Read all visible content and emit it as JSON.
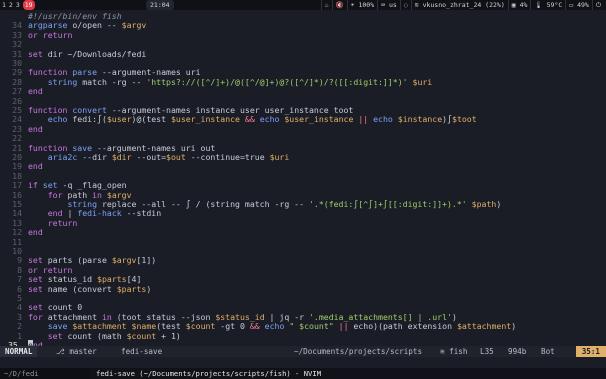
{
  "topbar": {
    "workspaces": [
      "1",
      "2",
      "3",
      "19"
    ],
    "active_workspace": "19",
    "clock": "21:04",
    "status_items": [
      {
        "icon": "steam-icon",
        "text": ""
      },
      {
        "icon": "volume-muted-icon",
        "text": ""
      },
      {
        "icon": "brightness-icon",
        "text": "100%"
      },
      {
        "icon": "keyboard-icon",
        "text": "us"
      },
      {
        "icon": "eye-off-icon",
        "text": ""
      },
      {
        "icon": "wifi-icon",
        "text": "vkusno_zhrat_24 (22%)"
      },
      {
        "icon": "cpu-icon",
        "text": "4%"
      },
      {
        "icon": "temperature-icon",
        "text": "59°C"
      },
      {
        "icon": "battery-icon",
        "text": "49%"
      },
      {
        "icon": "power-icon",
        "text": ""
      }
    ]
  },
  "editor": {
    "lines": [
      {
        "ln": "",
        "tokens": [
          [
            "cmt",
            "#!/usr/bin/env fish"
          ]
        ]
      },
      {
        "ln": "34",
        "tokens": [
          [
            "fn",
            "argparse"
          ],
          [
            "plain",
            " o/open -- "
          ],
          [
            "var",
            "$argv"
          ]
        ]
      },
      {
        "ln": "33",
        "tokens": [
          [
            "kw",
            "or"
          ],
          [
            "plain",
            " "
          ],
          [
            "kw",
            "return"
          ]
        ]
      },
      {
        "ln": "32",
        "tokens": []
      },
      {
        "ln": "31",
        "tokens": [
          [
            "kw",
            "set"
          ],
          [
            "plain",
            " dir ~/Downloads/fedi"
          ]
        ]
      },
      {
        "ln": "30",
        "tokens": []
      },
      {
        "ln": "29",
        "tokens": [
          [
            "kw",
            "function"
          ],
          [
            "plain",
            " "
          ],
          [
            "fn",
            "parse"
          ],
          [
            "plain",
            " --argument-names uri"
          ]
        ]
      },
      {
        "ln": "28",
        "tokens": [
          [
            "plain",
            "    "
          ],
          [
            "fn",
            "string"
          ],
          [
            "plain",
            " match -rg -- "
          ],
          [
            "str",
            "'https?://([^/]+)/@([^/@]+)@?([^/]*)/?([[:digit:]]*)'"
          ],
          [
            "plain",
            " "
          ],
          [
            "var",
            "$uri"
          ]
        ]
      },
      {
        "ln": "27",
        "tokens": [
          [
            "kw",
            "end"
          ]
        ]
      },
      {
        "ln": "26",
        "tokens": []
      },
      {
        "ln": "25",
        "tokens": [
          [
            "kw",
            "function"
          ],
          [
            "plain",
            " "
          ],
          [
            "fn",
            "convert"
          ],
          [
            "plain",
            " --argument-names instance user user_instance toot"
          ]
        ]
      },
      {
        "ln": "24",
        "tokens": [
          [
            "plain",
            "    "
          ],
          [
            "fn",
            "echo"
          ],
          [
            "plain",
            " fedi:∫("
          ],
          [
            "var",
            "$user"
          ],
          [
            "plain",
            ")@(test "
          ],
          [
            "var",
            "$user_instance"
          ],
          [
            "plain",
            " "
          ],
          [
            "op",
            "&&"
          ],
          [
            "plain",
            " "
          ],
          [
            "fn",
            "echo"
          ],
          [
            "plain",
            " "
          ],
          [
            "var",
            "$user_instance"
          ],
          [
            "plain",
            " "
          ],
          [
            "op",
            "||"
          ],
          [
            "plain",
            " "
          ],
          [
            "fn",
            "echo"
          ],
          [
            "plain",
            " "
          ],
          [
            "var",
            "$instance"
          ],
          [
            "plain",
            ")∫"
          ],
          [
            "var",
            "$toot"
          ]
        ]
      },
      {
        "ln": "23",
        "tokens": [
          [
            "kw",
            "end"
          ]
        ]
      },
      {
        "ln": "22",
        "tokens": []
      },
      {
        "ln": "21",
        "tokens": [
          [
            "kw",
            "function"
          ],
          [
            "plain",
            " "
          ],
          [
            "fn",
            "save"
          ],
          [
            "plain",
            " --argument-names uri out"
          ]
        ]
      },
      {
        "ln": "20",
        "tokens": [
          [
            "plain",
            "    "
          ],
          [
            "fn",
            "aria2c"
          ],
          [
            "plain",
            " --dir "
          ],
          [
            "var",
            "$dir"
          ],
          [
            "plain",
            " --out="
          ],
          [
            "var",
            "$out"
          ],
          [
            "plain",
            " --continue=true "
          ],
          [
            "var",
            "$uri"
          ]
        ]
      },
      {
        "ln": "19",
        "tokens": [
          [
            "kw",
            "end"
          ]
        ]
      },
      {
        "ln": "18",
        "tokens": []
      },
      {
        "ln": "17",
        "tokens": [
          [
            "kw",
            "if"
          ],
          [
            "plain",
            " "
          ],
          [
            "fn",
            "set"
          ],
          [
            "plain",
            " -q _flag_open"
          ]
        ]
      },
      {
        "ln": "16",
        "tokens": [
          [
            "plain",
            "    "
          ],
          [
            "kw",
            "for"
          ],
          [
            "plain",
            " path "
          ],
          [
            "kw",
            "in"
          ],
          [
            "plain",
            " "
          ],
          [
            "var",
            "$argv"
          ]
        ]
      },
      {
        "ln": "15",
        "tokens": [
          [
            "plain",
            "        "
          ],
          [
            "fn",
            "string"
          ],
          [
            "plain",
            " replace --all -- ∫ / (string match -rg -- "
          ],
          [
            "str",
            "'.*(fedi:∫[^∫]+∫[[:digit:]]+).*'"
          ],
          [
            "plain",
            " "
          ],
          [
            "var",
            "$path"
          ],
          [
            "plain",
            ")"
          ]
        ]
      },
      {
        "ln": "14",
        "tokens": [
          [
            "plain",
            "    "
          ],
          [
            "kw",
            "end"
          ],
          [
            "plain",
            " | "
          ],
          [
            "fn",
            "fedi-hack"
          ],
          [
            "plain",
            " --stdin"
          ]
        ]
      },
      {
        "ln": "13",
        "tokens": [
          [
            "plain",
            "    "
          ],
          [
            "kw",
            "return"
          ]
        ]
      },
      {
        "ln": "12",
        "tokens": [
          [
            "kw",
            "end"
          ]
        ]
      },
      {
        "ln": "11",
        "tokens": []
      },
      {
        "ln": "10",
        "tokens": []
      },
      {
        "ln": "9",
        "tokens": [
          [
            "kw",
            "set"
          ],
          [
            "plain",
            " parts (parse "
          ],
          [
            "var",
            "$argv"
          ],
          [
            "plain",
            "[1])"
          ]
        ]
      },
      {
        "ln": "8",
        "tokens": [
          [
            "kw",
            "or"
          ],
          [
            "plain",
            " "
          ],
          [
            "kw",
            "return"
          ]
        ]
      },
      {
        "ln": "7",
        "tokens": [
          [
            "kw",
            "set"
          ],
          [
            "plain",
            " status_id "
          ],
          [
            "var",
            "$parts"
          ],
          [
            "plain",
            "[4]"
          ]
        ]
      },
      {
        "ln": "6",
        "tokens": [
          [
            "kw",
            "set"
          ],
          [
            "plain",
            " name (convert "
          ],
          [
            "var",
            "$parts"
          ],
          [
            "plain",
            ")"
          ]
        ]
      },
      {
        "ln": "5",
        "tokens": []
      },
      {
        "ln": "4",
        "tokens": [
          [
            "kw",
            "set"
          ],
          [
            "plain",
            " count 0"
          ]
        ]
      },
      {
        "ln": "3",
        "tokens": [
          [
            "kw",
            "for"
          ],
          [
            "plain",
            " attachment "
          ],
          [
            "kw",
            "in"
          ],
          [
            "plain",
            " (toot status --json "
          ],
          [
            "var",
            "$status_id"
          ],
          [
            "plain",
            " | jq -r "
          ],
          [
            "str",
            "'.media_attachments[] | .url'"
          ],
          [
            "plain",
            ")"
          ]
        ]
      },
      {
        "ln": "2",
        "tokens": [
          [
            "plain",
            "    "
          ],
          [
            "fn",
            "save"
          ],
          [
            "plain",
            " "
          ],
          [
            "var",
            "$attachment"
          ],
          [
            "plain",
            " "
          ],
          [
            "var",
            "$name"
          ],
          [
            "plain",
            "(test "
          ],
          [
            "var",
            "$count"
          ],
          [
            "plain",
            " -gt 0 "
          ],
          [
            "op",
            "&&"
          ],
          [
            "plain",
            " "
          ],
          [
            "fn",
            "echo"
          ],
          [
            "plain",
            " "
          ],
          [
            "str",
            "\" $count\""
          ],
          [
            "plain",
            " "
          ],
          [
            "op",
            "||"
          ],
          [
            "plain",
            " echo)(path extension "
          ],
          [
            "var",
            "$attachment"
          ],
          [
            "plain",
            ")"
          ]
        ]
      },
      {
        "ln": "1",
        "tokens": [
          [
            "plain",
            "    "
          ],
          [
            "kw",
            "set"
          ],
          [
            "plain",
            " count (math "
          ],
          [
            "var",
            "$count"
          ],
          [
            "plain",
            " + 1)"
          ]
        ]
      },
      {
        "ln": "35",
        "current": true,
        "tokens": [
          [
            "cursor",
            "e"
          ],
          [
            "kw",
            "nd"
          ]
        ]
      }
    ]
  },
  "statusline": {
    "mode": "NORMAL",
    "branch": "master",
    "filename": "fedi-save",
    "path": "~/Documents/projects/scripts",
    "filetype": "fish",
    "lines": "L35",
    "size": "994b",
    "position": "Bot",
    "cursor": "35:1"
  },
  "bottombar": {
    "task": "~/D/fedi",
    "window_title": "fedi-save (~/Documents/projects/scripts/fish) - NVIM"
  }
}
